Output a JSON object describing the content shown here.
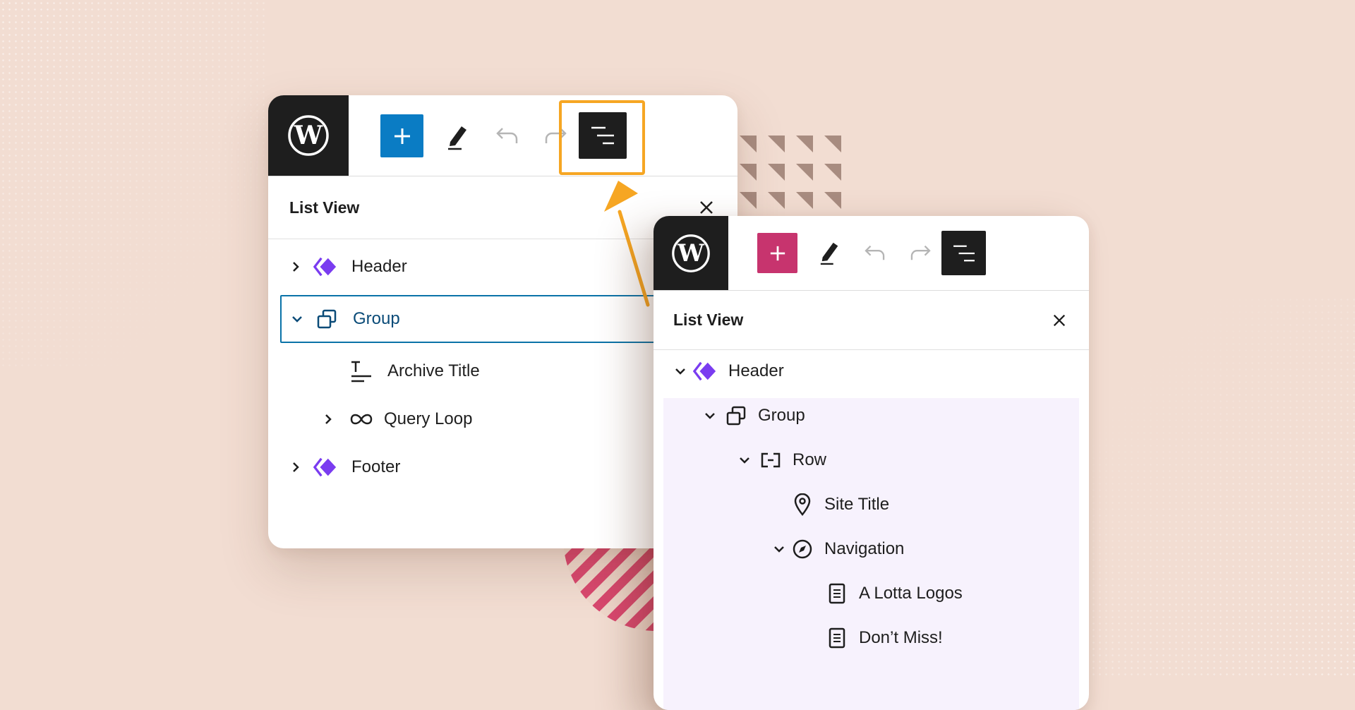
{
  "colors": {
    "background": "#f2ddd2",
    "inserter_blue": "#0a7cc4",
    "inserter_pink": "#c7346e",
    "wp_dark": "#1e1e1e",
    "callout_orange": "#f6a623",
    "selected_outline": "#0a73a8",
    "template_part_purple": "#7a3cf0",
    "highlight_lavender": "#f7f2fd"
  },
  "panel_left": {
    "toolbar": {
      "logo": "wordpress-logo",
      "buttons": [
        "plus-icon",
        "pencil-icon",
        "undo-icon",
        "redo-icon",
        "list-view-icon"
      ]
    },
    "list_view": {
      "title": "List View",
      "items": [
        {
          "label": "Header",
          "icon": "template-part-icon",
          "chevron": "right"
        },
        {
          "label": "Group",
          "icon": "group-icon",
          "chevron": "down",
          "selected": true
        },
        {
          "label": "Archive Title",
          "icon": "archive-title-icon",
          "chevron": "none"
        },
        {
          "label": "Query Loop",
          "icon": "loop-icon",
          "chevron": "right"
        },
        {
          "label": "Footer",
          "icon": "template-part-icon",
          "chevron": "right"
        }
      ]
    }
  },
  "panel_right": {
    "toolbar": {
      "logo": "wordpress-logo",
      "buttons": [
        "plus-icon",
        "pencil-icon",
        "undo-icon",
        "redo-icon",
        "list-view-icon"
      ]
    },
    "list_view": {
      "title": "List View",
      "items": [
        {
          "label": "Header",
          "icon": "template-part-icon",
          "chevron": "down"
        },
        {
          "label": "Group",
          "icon": "group-icon",
          "chevron": "down"
        },
        {
          "label": "Row",
          "icon": "row-icon",
          "chevron": "down"
        },
        {
          "label": "Site Title",
          "icon": "map-pin-icon",
          "chevron": "none"
        },
        {
          "label": "Navigation",
          "icon": "compass-icon",
          "chevron": "down"
        },
        {
          "label": "A Lotta Logos",
          "icon": "page-icon",
          "chevron": "none"
        },
        {
          "label": "Don’t Miss!",
          "icon": "page-icon",
          "chevron": "none"
        }
      ]
    }
  }
}
